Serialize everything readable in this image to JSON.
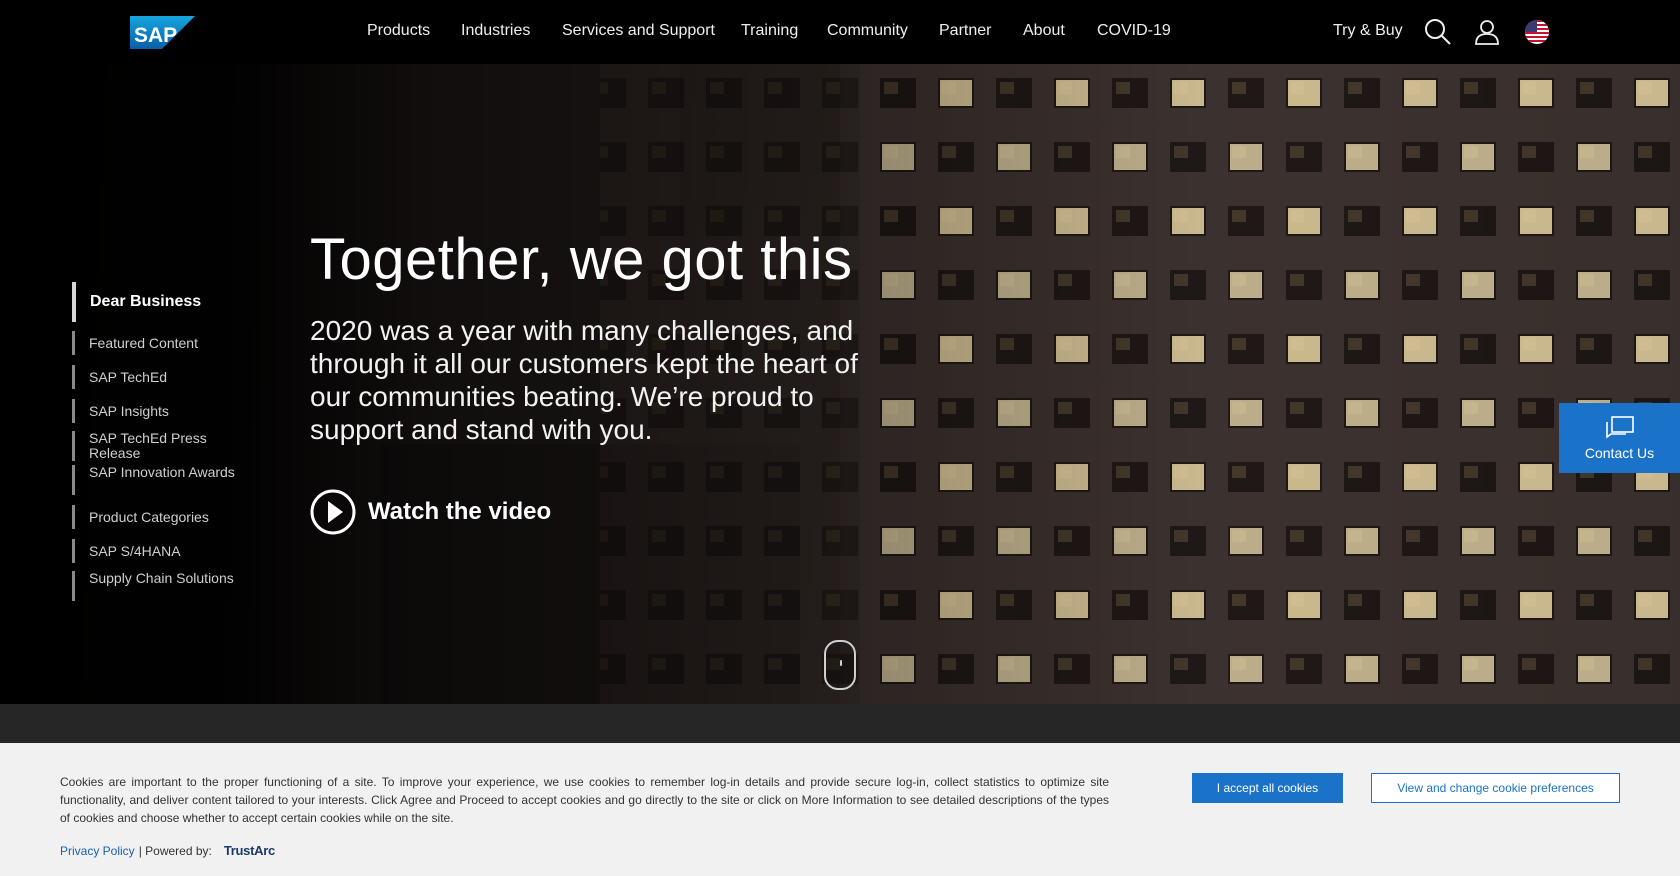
{
  "header": {
    "logo_text": "SAP",
    "nav": [
      "Products",
      "Industries",
      "Services and Support",
      "Training",
      "Community",
      "Partner",
      "About",
      "COVID-19"
    ],
    "try_buy": "Try & Buy",
    "icons": [
      "search-icon",
      "user-icon",
      "us-flag-icon"
    ]
  },
  "side_nav": {
    "items": [
      {
        "label": "Dear Business",
        "active": true
      },
      {
        "label": "Featured Content"
      },
      {
        "label": "SAP TechEd"
      },
      {
        "label": "SAP Insights"
      },
      {
        "label": "SAP TechEd Press Release"
      },
      {
        "label": "SAP Innovation Awards"
      },
      {
        "label": "Product Categories"
      },
      {
        "label": "SAP S/4HANA"
      },
      {
        "label": "Supply Chain Solutions"
      }
    ]
  },
  "hero": {
    "headline": "Together, we got this",
    "subtext": "2020 was a year with many challenges, and through it all our customers kept the heart of our communities beating. We’re proud to support and stand with you.",
    "watch_label": "Watch the video"
  },
  "contact": {
    "label": "Contact Us"
  },
  "cookie": {
    "text": "Cookies are important to the proper functioning of a site. To improve your experience, we use cookies to remember log-in details and provide secure log-in, collect statistics to optimize site functionality, and deliver content tailored to your interests. Click Agree and Proceed to accept cookies and go directly to the site or click on More Information to see detailed descriptions of the types of cookies and choose whether to accept certain cookies while on the site.",
    "privacy_link": "Privacy Policy",
    "powered_by": "| Powered by:",
    "trustarc": "TrustArc",
    "accept_button": "I accept all cookies",
    "prefs_button": "View and change cookie preferences"
  },
  "colors": {
    "accent": "#1a73c8",
    "cookie_bg": "#f1f1f1",
    "band": "#262626"
  }
}
